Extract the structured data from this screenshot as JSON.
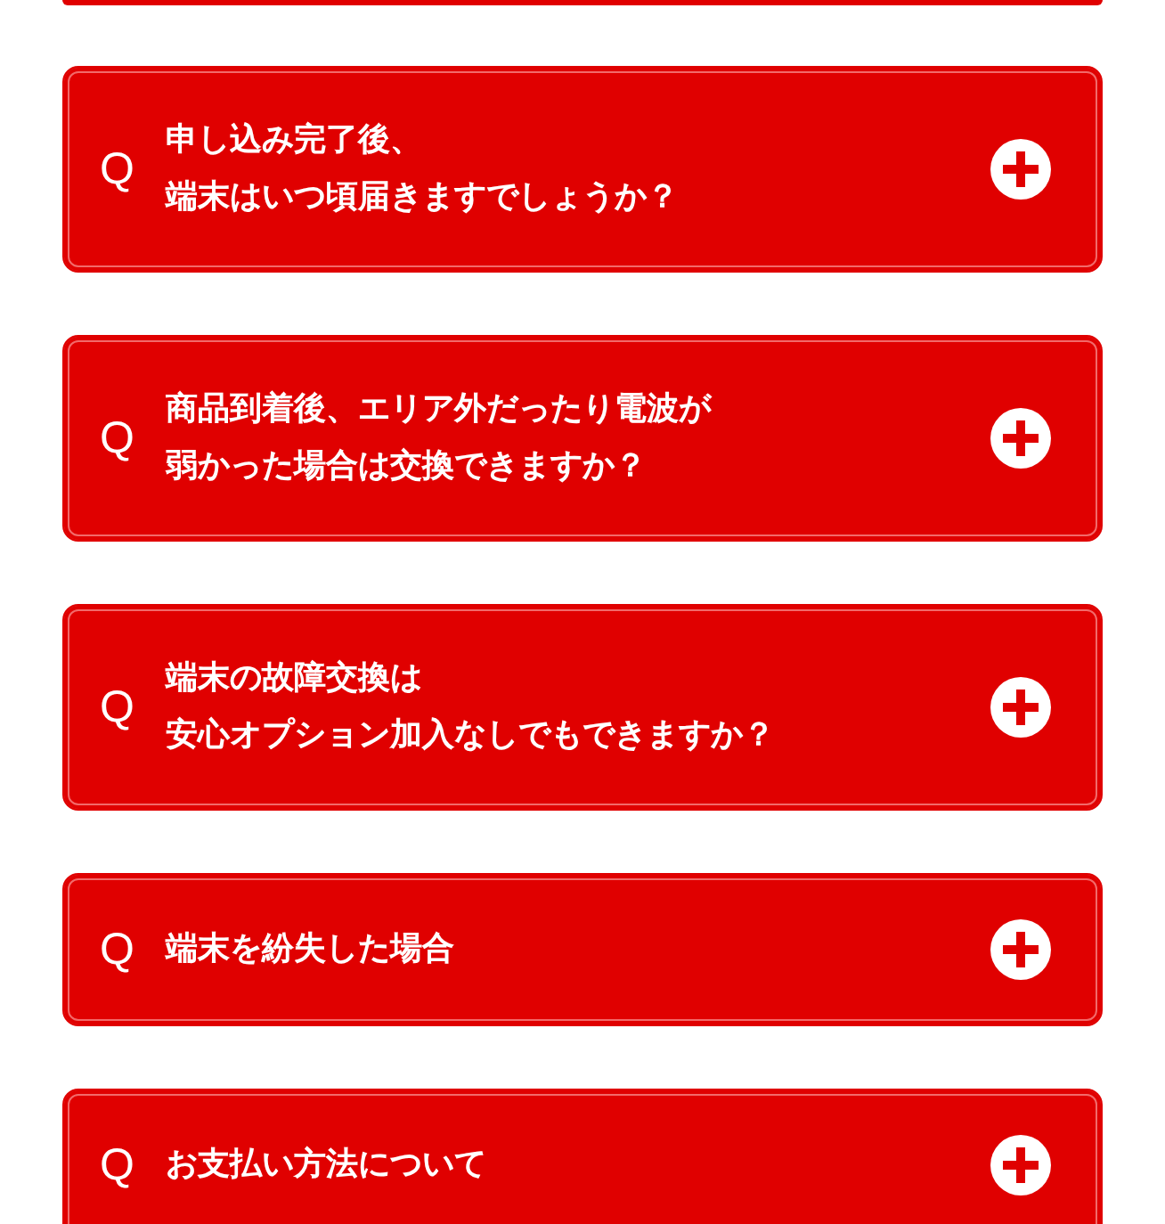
{
  "faq": [
    {
      "marker": "Q",
      "lines": [
        "申し込み完了後、",
        "端末はいつ頃届きますでしょうか？"
      ],
      "expanded": false
    },
    {
      "marker": "Q",
      "lines": [
        "商品到着後、エリア外だったり電波が",
        "弱かった場合は交換できますか？"
      ],
      "expanded": false
    },
    {
      "marker": "Q",
      "lines": [
        "端末の故障交換は",
        "安心オプション加入なしでもできますか？"
      ],
      "expanded": false
    },
    {
      "marker": "Q",
      "lines": [
        "端末を紛失した場合"
      ],
      "expanded": false
    },
    {
      "marker": "Q",
      "lines": [
        "お支払い方法について"
      ],
      "expanded": false
    }
  ]
}
